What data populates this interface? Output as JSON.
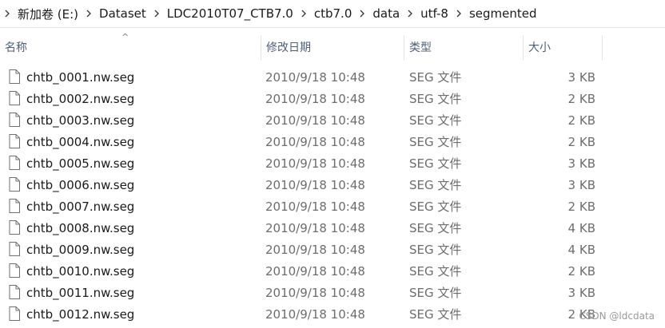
{
  "breadcrumb": {
    "segments": [
      "新加卷 (E:)",
      "Dataset",
      "LDC2010T07_CTB7.0",
      "ctb7.0",
      "data",
      "utf-8",
      "segmented"
    ]
  },
  "columns": {
    "name": "名称",
    "date": "修改日期",
    "type": "类型",
    "size": "大小",
    "sort_indicator": "^"
  },
  "files": [
    {
      "name": "chtb_0001.nw.seg",
      "date": "2010/9/18 10:48",
      "type": "SEG 文件",
      "size": "3 KB"
    },
    {
      "name": "chtb_0002.nw.seg",
      "date": "2010/9/18 10:48",
      "type": "SEG 文件",
      "size": "2 KB"
    },
    {
      "name": "chtb_0003.nw.seg",
      "date": "2010/9/18 10:48",
      "type": "SEG 文件",
      "size": "2 KB"
    },
    {
      "name": "chtb_0004.nw.seg",
      "date": "2010/9/18 10:48",
      "type": "SEG 文件",
      "size": "2 KB"
    },
    {
      "name": "chtb_0005.nw.seg",
      "date": "2010/9/18 10:48",
      "type": "SEG 文件",
      "size": "3 KB"
    },
    {
      "name": "chtb_0006.nw.seg",
      "date": "2010/9/18 10:48",
      "type": "SEG 文件",
      "size": "3 KB"
    },
    {
      "name": "chtb_0007.nw.seg",
      "date": "2010/9/18 10:48",
      "type": "SEG 文件",
      "size": "2 KB"
    },
    {
      "name": "chtb_0008.nw.seg",
      "date": "2010/9/18 10:48",
      "type": "SEG 文件",
      "size": "4 KB"
    },
    {
      "name": "chtb_0009.nw.seg",
      "date": "2010/9/18 10:48",
      "type": "SEG 文件",
      "size": "4 KB"
    },
    {
      "name": "chtb_0010.nw.seg",
      "date": "2010/9/18 10:48",
      "type": "SEG 文件",
      "size": "2 KB"
    },
    {
      "name": "chtb_0011.nw.seg",
      "date": "2010/9/18 10:48",
      "type": "SEG 文件",
      "size": "3 KB"
    },
    {
      "name": "chtb_0012.nw.seg",
      "date": "2010/9/18 10:48",
      "type": "SEG 文件",
      "size": "2 KB"
    }
  ],
  "watermark": "CSDN @ldcdata"
}
